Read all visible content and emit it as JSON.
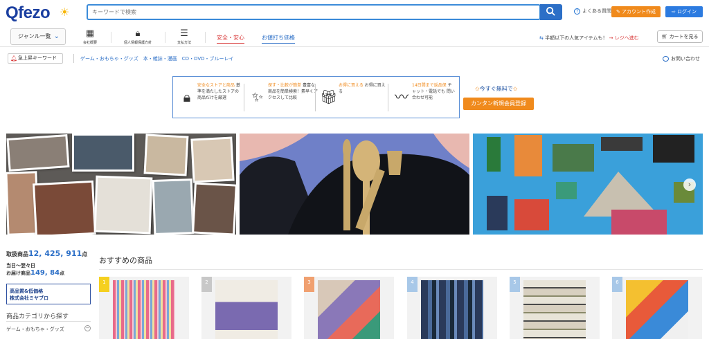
{
  "header": {
    "logo": "Qfezo",
    "search_placeholder": "キーワードで検索",
    "faq": "よくある質問",
    "account_button": "アカウント作成",
    "login_button": "ログイン"
  },
  "nav": {
    "genre_label": "ジャンル一覧",
    "icons": [
      {
        "label": "会社概要",
        "icon": "building-icon"
      },
      {
        "label": "個人情報保護方針",
        "icon": "lock-icon"
      },
      {
        "label": "支払方法",
        "icon": "coins-icon"
      }
    ],
    "safe_link": "安全・安心",
    "price_link": "お値打ち価格",
    "popular_text": "半額以下の人気アイテムも！",
    "popular_link": "→ レジへ進む",
    "cart_button": "カートを見る"
  },
  "keywords": {
    "button": "急上昇キーワード",
    "links": "ゲーム・おもちゃ・グッズ　本・雑誌・漫画　CD・DVD・ブルーレイ",
    "contact": "お問い合わせ"
  },
  "features": [
    {
      "highlight": "安全なストアと商品",
      "text": "基準を満たしたストアの 商品だけを厳選"
    },
    {
      "highlight": "探す・比較が簡単",
      "text": "豊富な商品を簡単検索！素早くアクセスして比較"
    },
    {
      "highlight": "お得に買える",
      "text": "お得に買える"
    },
    {
      "highlight": "14日間まで返品保",
      "text": "チャット・電話でも 問い合わせ可能"
    }
  ],
  "free_text": "今すぐ無料で",
  "register_button": "カンタン新規会員登録",
  "stats": {
    "items_label": "取扱商品",
    "items_value": "12, 425, 911",
    "items_unit": "点",
    "delivery_label": "当日～翌々日",
    "delivery_prefix": "お届け商品",
    "delivery_value": "149, 84",
    "delivery_unit": "点"
  },
  "shop_box": [
    "高品質&低価格",
    "株式会社ミヤブロ"
  ],
  "category_title": "商品カテゴリから探す",
  "category_item": "ゲーム・おもちゃ・グッズ",
  "recommended_title": "おすすめの商品",
  "cards": [
    {
      "rank": "1",
      "rank_color": "#f5d020"
    },
    {
      "rank": "2",
      "rank_color": "#c8c8c8"
    },
    {
      "rank": "3",
      "rank_color": "#f0a070"
    },
    {
      "rank": "4",
      "rank_color": "#a8c8e8"
    },
    {
      "rank": "5",
      "rank_color": "#a8c8e8"
    },
    {
      "rank": "6",
      "rank_color": "#a8c8e8"
    }
  ],
  "colors": {
    "brand": "#1b3fa0",
    "accent_orange": "#f08a1c",
    "accent_blue": "#2c6fc7",
    "accent_red": "#d93a3a"
  }
}
